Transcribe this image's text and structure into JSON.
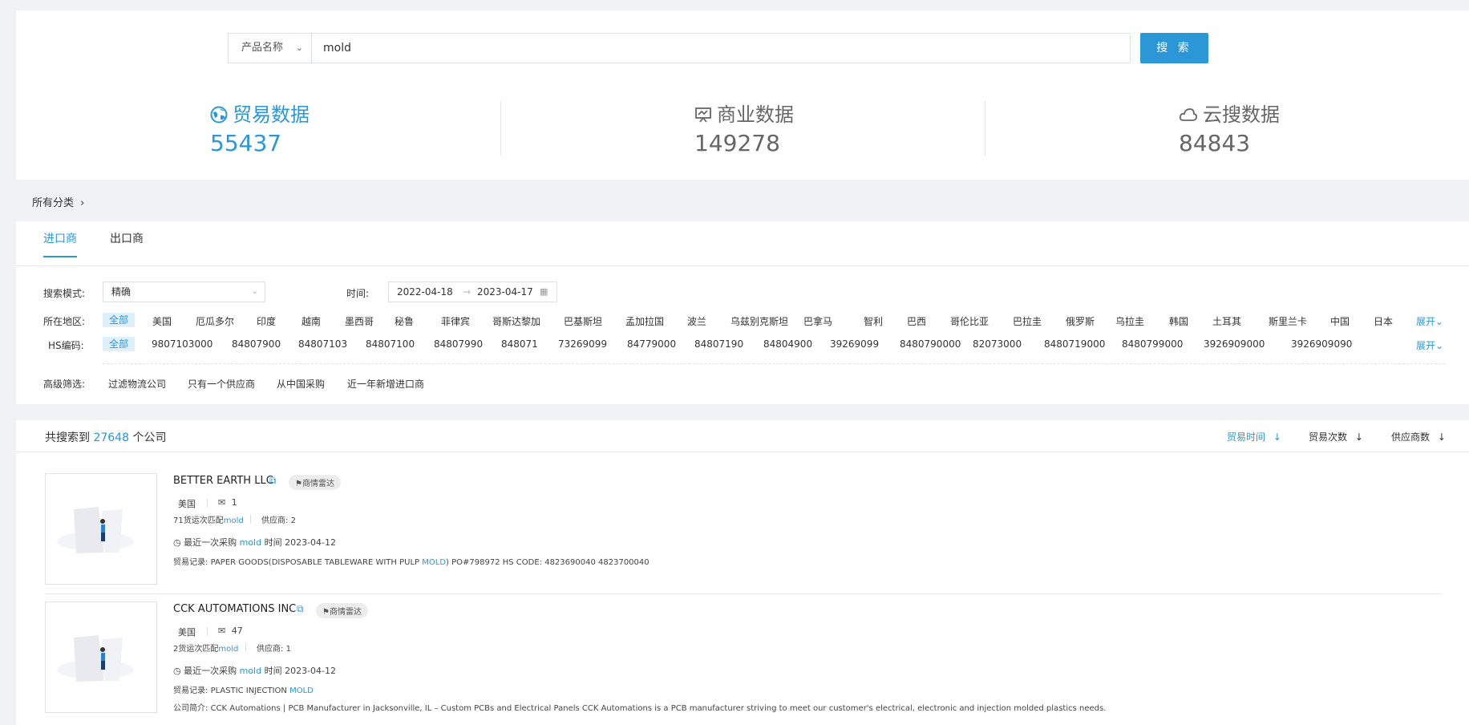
{
  "search": {
    "select_value": "产品名称",
    "query": "mold",
    "button_label": "搜 索"
  },
  "stats": [
    {
      "label": "贸易数据",
      "value": "55437",
      "icon": "globe-icon"
    },
    {
      "label": "商业数据",
      "value": "149278",
      "icon": "monitor-chart-icon"
    },
    {
      "label": "云搜数据",
      "value": "84843",
      "icon": "cloud-icon"
    }
  ],
  "breadcrumb": {
    "label": "所有分类"
  },
  "tabs": [
    {
      "label": "进口商",
      "active": true
    },
    {
      "label": "出口商",
      "active": false
    }
  ],
  "filters": {
    "mode_label": "搜索模式:",
    "mode_value": "精确",
    "time_label": "时间:",
    "date_start": "2022-04-18",
    "date_end": "2023-04-17",
    "region_label": "所在地区:",
    "regions": [
      "全部",
      "美国",
      "厄瓜多尔",
      "印度",
      "越南",
      "墨西哥",
      "秘鲁",
      "菲律宾",
      "哥斯达黎加",
      "巴基斯坦",
      "孟加拉国",
      "波兰",
      "乌兹别克斯坦",
      "巴拿马",
      "智利",
      "巴西",
      "哥伦比亚",
      "巴拉圭",
      "俄罗斯",
      "乌拉圭",
      "韩国",
      "土耳其",
      "斯里兰卡",
      "中国",
      "日本"
    ],
    "hs_label": "HS编码:",
    "hs_codes": [
      "全部",
      "9807103000",
      "84807900",
      "84807103",
      "84807100",
      "84807990",
      "848071",
      "73269099",
      "84779000",
      "84807190",
      "84804900",
      "39269099",
      "8480790000",
      "82073000",
      "8480719000",
      "8480799000",
      "3926909000",
      "3926909090"
    ],
    "expand_label": "展开",
    "advanced_label": "高级筛选:",
    "advanced_options": [
      "过滤物流公司",
      "只有一个供应商",
      "从中国采购",
      "近一年新增进口商"
    ]
  },
  "results": {
    "prefix": "共搜索到",
    "count": "27648",
    "suffix": "个公司",
    "sorts": [
      "贸易时间",
      "贸易次数",
      "供应商数"
    ]
  },
  "companies": [
    {
      "name": "BETTER EARTH LLC",
      "radar": "商情雷达",
      "country": "美国",
      "mail_count": "1",
      "match_prefix": "71货运次匹配",
      "match_kw": "mold",
      "supplier_label": "供应商:",
      "supplier_count": "2",
      "recent_prefix": "最近一次采购",
      "recent_kw": "mold",
      "recent_time_label": "时间",
      "recent_date": "2023-04-12",
      "record_label": "贸易记录:",
      "record_pre": "PAPER GOODS(DISPOSABLE TABLEWARE WITH PULP",
      "record_kw": "MOLD",
      "record_post": ") PO#798972 HS CODE: 4823690040 4823700040",
      "intro_label": "",
      "intro": ""
    },
    {
      "name": "CCK AUTOMATIONS INC",
      "radar": "商情雷达",
      "country": "美国",
      "mail_count": "47",
      "match_prefix": "2货运次匹配",
      "match_kw": "mold",
      "supplier_label": "供应商:",
      "supplier_count": "1",
      "recent_prefix": "最近一次采购",
      "recent_kw": "mold",
      "recent_time_label": "时间",
      "recent_date": "2023-04-12",
      "record_label": "贸易记录:",
      "record_pre": "PLASTIC INJECTION",
      "record_kw": "MOLD",
      "record_post": "",
      "intro_label": "公司简介:",
      "intro": "CCK Automations | PCB Manufacturer in Jacksonville, IL – Custom PCBs and Electrical Panels CCK Automations is a PCB manufacturer striving to meet our customer's electrical, electronic and injection molded plastics needs."
    }
  ]
}
